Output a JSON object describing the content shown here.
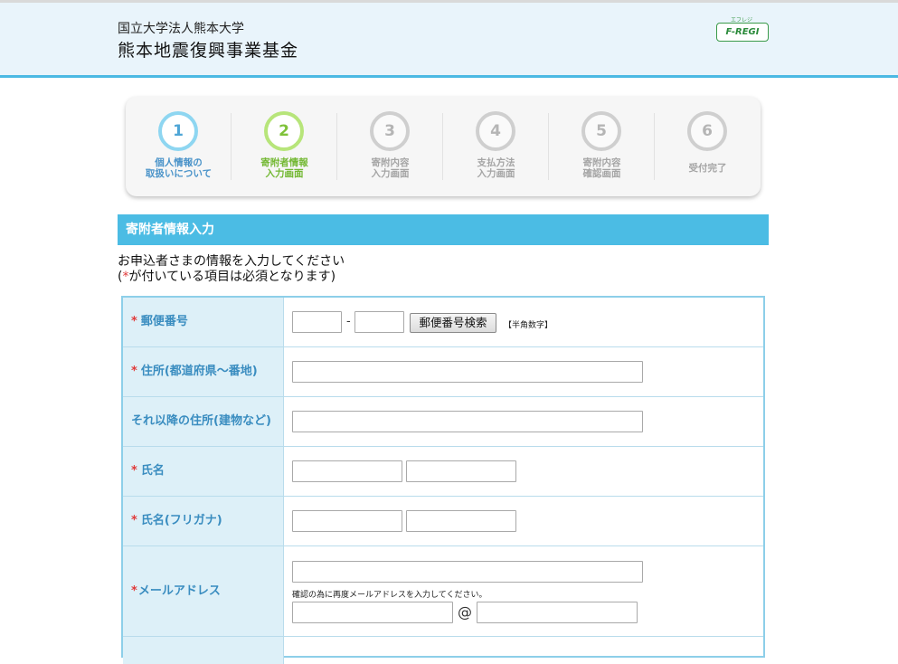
{
  "header": {
    "org_name": "国立大学法人熊本大学",
    "fund_name": "熊本地震復興事業基金",
    "logo_text": "F-REGI",
    "logo_ruby": "エフレジ"
  },
  "steps": [
    {
      "num": "1",
      "label_line1": "個人情報の",
      "label_line2": "取扱いについて",
      "state": "done"
    },
    {
      "num": "2",
      "label_line1": "寄附者情報",
      "label_line2": "入力画面",
      "state": "current"
    },
    {
      "num": "3",
      "label_line1": "寄附内容",
      "label_line2": "入力画面",
      "state": "pending"
    },
    {
      "num": "4",
      "label_line1": "支払方法",
      "label_line2": "入力画面",
      "state": "pending"
    },
    {
      "num": "5",
      "label_line1": "寄附内容",
      "label_line2": "確認画面",
      "state": "pending"
    },
    {
      "num": "6",
      "label_line1": "受付完了",
      "label_line2": "",
      "state": "pending"
    }
  ],
  "section_title": "寄附者情報入力",
  "intro": {
    "line1": "お申込者さまの情報を入力してください",
    "line2_prefix": "(",
    "line2_star": "*",
    "line2_rest": "が付いている項目は必須となります)"
  },
  "form": {
    "required_mark": "*",
    "postal": {
      "label": "郵便番号",
      "dash": "-",
      "search_button": "郵便番号検索",
      "hint": "【半角数字】",
      "value1": "",
      "value2": ""
    },
    "address1": {
      "label": "住所(都道府県～番地)",
      "value": ""
    },
    "address2": {
      "label": "それ以降の住所(建物など)",
      "value": ""
    },
    "name": {
      "label": "氏名",
      "last": "",
      "first": ""
    },
    "name_kana": {
      "label": "氏名(フリガナ)",
      "last": "",
      "first": ""
    },
    "email": {
      "label": "メールアドレス",
      "value": "",
      "confirm_note": "確認の為に再度メールアドレスを入力してください。",
      "at": "@",
      "confirm_local": "",
      "confirm_domain": ""
    }
  }
}
